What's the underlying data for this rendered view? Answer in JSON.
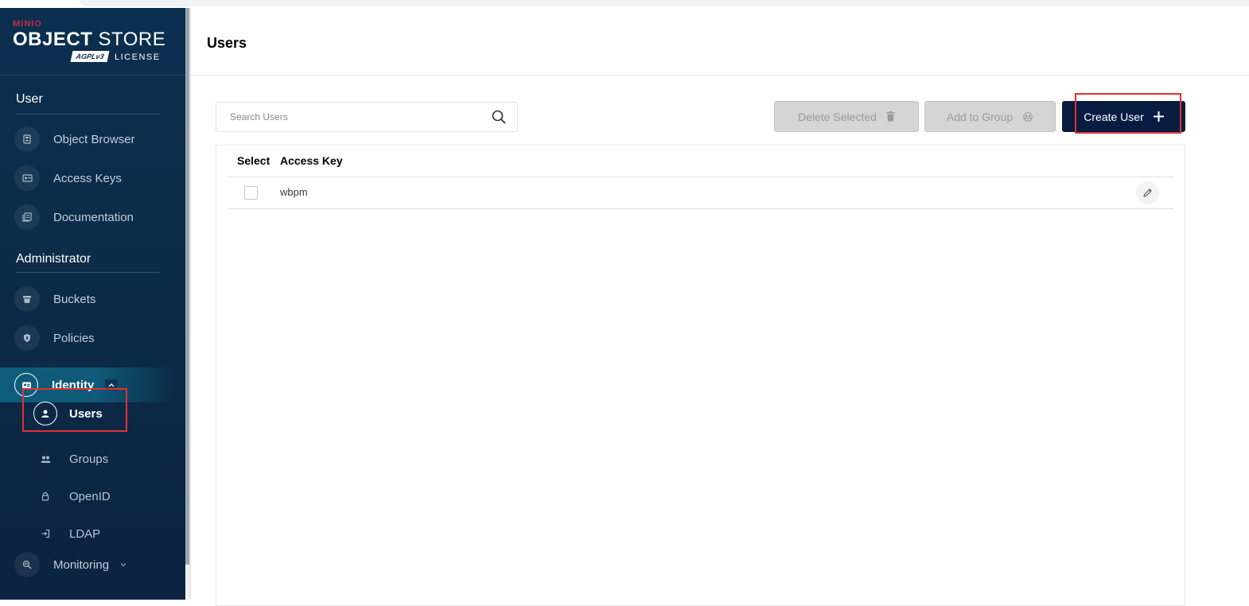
{
  "brand": {
    "company": "MINIO",
    "product_bold": "OBJECT",
    "product_light": "STORE",
    "license_badge": "AGPLv3",
    "license_text": "LICENSE"
  },
  "sidebar": {
    "sections": [
      {
        "title": "User",
        "items": [
          {
            "label": "Object Browser",
            "icon": "object-browser-icon"
          },
          {
            "label": "Access Keys",
            "icon": "access-keys-icon"
          },
          {
            "label": "Documentation",
            "icon": "documentation-icon"
          }
        ]
      },
      {
        "title": "Administrator",
        "items": [
          {
            "label": "Buckets",
            "icon": "bucket-icon"
          },
          {
            "label": "Policies",
            "icon": "shield-icon"
          },
          {
            "label": "Identity",
            "icon": "identity-card-icon",
            "expanded": true,
            "children": [
              {
                "label": "Users",
                "icon": "user-icon",
                "active": true
              },
              {
                "label": "Groups",
                "icon": "groups-icon"
              },
              {
                "label": "OpenID",
                "icon": "lock-icon"
              },
              {
                "label": "LDAP",
                "icon": "login-icon"
              }
            ]
          },
          {
            "label": "Monitoring",
            "icon": "monitoring-icon",
            "expanded": false
          }
        ]
      }
    ]
  },
  "page": {
    "title": "Users"
  },
  "toolbar": {
    "search_placeholder": "Search Users",
    "delete_label": "Delete Selected",
    "add_group_label": "Add to Group",
    "create_label": "Create User"
  },
  "table": {
    "columns": [
      "Select",
      "Access Key"
    ],
    "rows": [
      {
        "access_key": "wbpm",
        "selected": false
      }
    ]
  },
  "colors": {
    "sidebar_bg": "#0b2f4f",
    "active_item": "#0e5c7a",
    "primary_button": "#081c42",
    "highlight": "#e03131"
  }
}
